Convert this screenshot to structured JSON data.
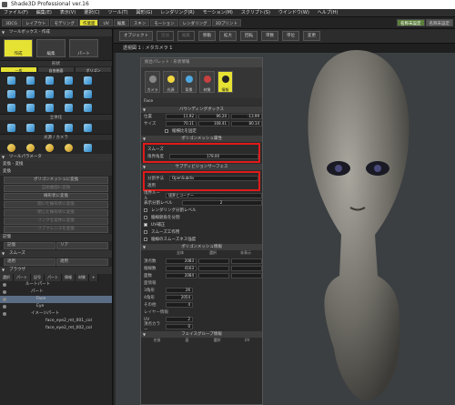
{
  "app": {
    "title": "Shade3D Professional ver.16"
  },
  "menu": [
    "ファイル(F)",
    "編集(E)",
    "表示(V)",
    "選択(C)",
    "ツール(T)",
    "図形(G)",
    "レンダリング(R)",
    "モーション(M)",
    "スクリプト(S)",
    "ウインドウ(W)",
    "ヘルプ(H)"
  ],
  "ribbon": {
    "tabs": [
      "3DCG",
      "レイアウト",
      "モデリング",
      "作業面",
      "UV",
      "編集",
      "スキン",
      "モーション",
      "レンダリング",
      "3Dプリント"
    ],
    "right_tabs": [
      "名称未設定",
      "名称未設定"
    ]
  },
  "left": {
    "toolbox_title": "ツールボックス - 作成",
    "big_buttons": [
      "作成",
      "編集",
      "パート"
    ],
    "shape_title": "形状",
    "shape_tabs": [
      "一般",
      "自由曲面",
      "ポリゴン"
    ],
    "solid_title": "立体化",
    "light_title": "光源 / カメラ",
    "params_title": "ツールパラメータ",
    "params_sub": "変換 - 変換",
    "convert_title": "変換",
    "convert_buttons": [
      "ポリゴンメッシュに変換",
      "自由曲面に変換",
      "線形状に変換",
      "開いた線形状に変換",
      "閉じた線形状に変換",
      "リンクを実体に変換",
      "リファレンスを変換"
    ],
    "memory_title": "記憶",
    "memory_buttons": [
      "記憶",
      "リア"
    ],
    "smooth_title": "スムーズ",
    "smooth_buttons": [
      "適用",
      "適用"
    ],
    "browser_title": "ブラウザ",
    "browser_tabs": [
      "選択",
      "パート",
      "記号",
      "パート",
      "情報",
      "材質",
      "+"
    ],
    "tree": [
      "ルートパート",
      "パート",
      "Face",
      "Eye",
      "イメージパート",
      "face_eye2_mt_001_col",
      "face_eye2_mt_002_col"
    ]
  },
  "toolbar": {
    "buttons": [
      "オブジェクト",
      "追加",
      "編集",
      "移動",
      "拡大",
      "回転",
      "単数",
      "単位",
      "変更"
    ]
  },
  "viewport": {
    "tab": "透視図 1 : メタカメラ 1"
  },
  "dialog": {
    "title": "統合パレット : 形状情報",
    "tabs": [
      "カメラ",
      "光源",
      "背景",
      "材質",
      "情報"
    ],
    "obj_name": "Face",
    "bbox_title": "バウンディングボックス",
    "pos_label": "位置",
    "size_label": "サイズ",
    "pos": [
      "11.92",
      "96.20",
      "-13.99"
    ],
    "size": [
      "70.11",
      "108.41",
      "80.14"
    ],
    "keep_ratio": "縦横比を固定",
    "mesh_title": "ポリゴンメッシュ属性",
    "smooth_label": "スムーズ",
    "limit_label": "限界角度",
    "limit_value": "178.00",
    "subd_title": "サブディビジョンサーフェス",
    "method_label": "分割手法",
    "method_value": "OpenSubdiv",
    "apply_label": "適用",
    "type_label": "境界ルール",
    "type_value": "境界とコーナー",
    "subd_level_label": "表示分割レベル",
    "subd_level": "2",
    "render_label": "レンダリング分割レベル",
    "sharp_label": "稜線鋭角を分割",
    "uv_label": "UV補正",
    "smooth_label2": "スムーズ工作用",
    "shade_label": "稜線のスムーズネス強度",
    "info_title": "ポリゴンメッシュ情報",
    "info_cols": [
      "全体",
      "選択",
      "非表示"
    ],
    "info_rows": [
      {
        "label": "頂点数",
        "v": "2083"
      },
      {
        "label": "稜線数",
        "v": "4163"
      },
      {
        "label": "面数",
        "v": "2084"
      }
    ],
    "face_title": "面情報",
    "faces": [
      {
        "label": "3角形",
        "v": "26"
      },
      {
        "label": "4角形",
        "v": "2054"
      },
      {
        "label": "その他",
        "v": "4"
      }
    ],
    "layer_title": "レイヤー情報",
    "layers": [
      {
        "label": "UV",
        "v": "2"
      },
      {
        "label": "頂点カラー",
        "v": "0"
      }
    ],
    "group_title": "フェイスグループ情報",
    "group_cols": [
      "名前",
      "面",
      "選択",
      "UV"
    ]
  }
}
